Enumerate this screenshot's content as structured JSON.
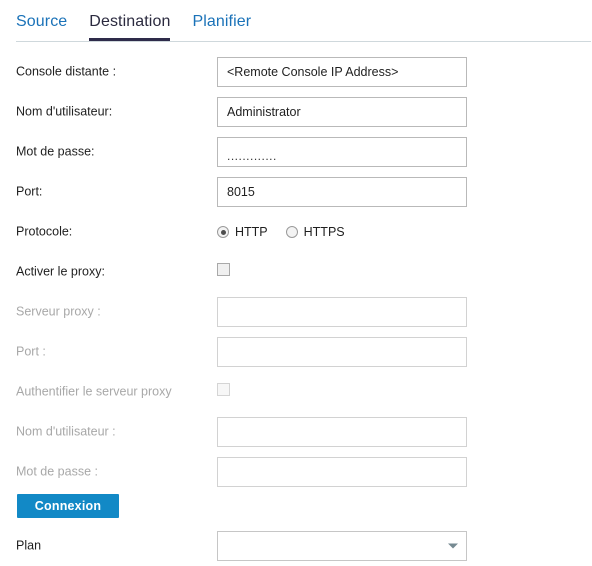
{
  "tabs": [
    {
      "label": "Source",
      "active": false
    },
    {
      "label": "Destination",
      "active": true
    },
    {
      "label": "Planifier",
      "active": false
    }
  ],
  "form": {
    "remote_console": {
      "label": "Console distante :",
      "value": "<Remote Console IP Address>"
    },
    "username": {
      "label": "Nom d'utilisateur:",
      "value": "Administrator"
    },
    "password": {
      "label": "Mot de passe:",
      "value": "............."
    },
    "port": {
      "label": "Port:",
      "value": "8015"
    },
    "protocol": {
      "label": "Protocole:",
      "options": [
        {
          "label": "HTTP",
          "selected": true
        },
        {
          "label": "HTTPS",
          "selected": false
        }
      ]
    },
    "enable_proxy": {
      "label": "Activer le proxy:",
      "checked": false
    },
    "proxy_server": {
      "label": "Serveur proxy :",
      "value": ""
    },
    "proxy_port": {
      "label": "Port :",
      "value": ""
    },
    "proxy_auth": {
      "label": "Authentifier le serveur proxy",
      "checked": false
    },
    "proxy_username": {
      "label": "Nom d'utilisateur :",
      "value": ""
    },
    "proxy_password": {
      "label": "Mot de passe :",
      "value": ""
    },
    "connect_button": {
      "label": "Connexion"
    },
    "plan": {
      "label": "Plan",
      "value": ""
    }
  },
  "icons": {
    "caret": "chevron-down-icon"
  },
  "colors": {
    "accent_blue": "#1289c6",
    "tab_link": "#1a72b8",
    "tab_active": "#2b2a3f",
    "tab_underline": "#2e2b4a",
    "rule": "#cfd8dc",
    "muted_text": "#a8a8a8"
  }
}
